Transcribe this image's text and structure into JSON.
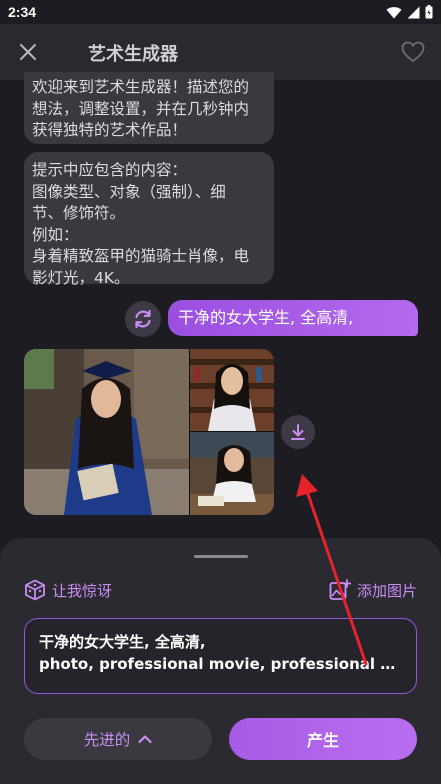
{
  "status_bar": {
    "time": "2:34",
    "icons": [
      "wifi-icon",
      "cellular-signal-icon",
      "battery-icon"
    ]
  },
  "header": {
    "title": "艺术生成器",
    "close_icon": "close-icon",
    "favorite_icon": "heart-outline-icon"
  },
  "chat": {
    "messages": [
      {
        "role": "bot",
        "text": "欢迎来到艺术生成器！描述您的\n想法，调整设置，并在几秒钟内\n获得独特的艺术作品！"
      },
      {
        "role": "bot",
        "text": "提示中应包含的内容：\n图像类型、对象（强制）、细\n节、修饰符。\n例如：\n身着精致盔甲的猫骑士肖像，电\n影灯光，4K。"
      },
      {
        "role": "user",
        "text": "干净的女大学生, 全高清,"
      }
    ],
    "regenerate_icon": "refresh-icon",
    "download_icon": "download-icon",
    "generated_images": [
      "graduate-in-gown-photo",
      "student-portrait-bookshelf-photo",
      "student-in-classroom-photo"
    ]
  },
  "panel": {
    "surprise_label": "让我惊讶",
    "surprise_icon": "dice-icon",
    "add_image_label": "添加图片",
    "add_image_icon": "add-image-icon",
    "prompt_line_1": "干净的女大学生, 全高清,",
    "prompt_line_2": "photo, professional movie, professional picture,...",
    "advanced_label": "先进的",
    "advanced_icon": "chevron-up-icon",
    "generate_label": "产生"
  },
  "colors": {
    "background": "#1d1c22",
    "header": "#2a2930",
    "bubble": "#3a3940",
    "accent": "#b469ee",
    "accent_text": "#c98df5",
    "annotation_arrow": "#e8222a"
  }
}
